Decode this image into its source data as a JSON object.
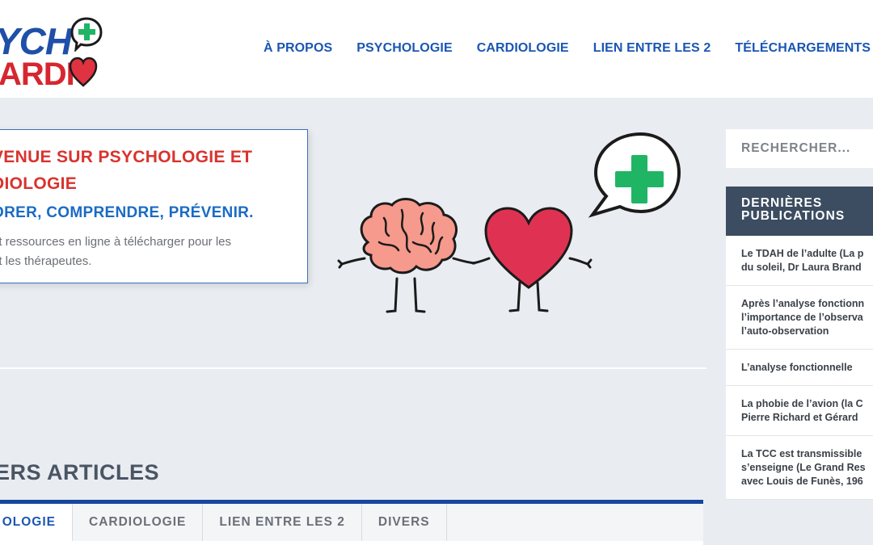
{
  "logo": {
    "top_text": "YCH",
    "bottom_text": "ARDI"
  },
  "nav": {
    "items": [
      "À PROPOS",
      "PSYCHOLOGIE",
      "CARDIOLOGIE",
      "LIEN ENTRE LES 2",
      "TÉLÉCHARGEMENTS"
    ]
  },
  "hero": {
    "title_line1": "VENUE SUR PSYCHOLOGIE ET",
    "title_line2": "DIOLOGIE",
    "subtitle": "ORER, COMPRENDRE, PRÉVENIR.",
    "desc_line1": "et ressources en ligne à télécharger pour les",
    "desc_line2": "et les thérapeutes."
  },
  "articles": {
    "title": "IERS ARTICLES",
    "tabs": [
      "OLOGIE",
      "CARDIOLOGIE",
      "LIEN ENTRE LES 2",
      "DIVERS"
    ]
  },
  "sidebar": {
    "search_placeholder": "RECHERCHER...",
    "widget_title_line1": "DERNIÈRES",
    "widget_title_line2": "PUBLICATIONS",
    "posts": [
      {
        "l1": "Le TDAH de l’adulte (La p",
        "l2": "du soleil, Dr Laura Brand"
      },
      {
        "l1": "Après l’analyse fonctionn",
        "l2": "l’importance de l’observa",
        "l3": "l’auto-observation"
      },
      {
        "l1": "L’analyse fonctionnelle"
      },
      {
        "l1": "La phobie de l’avion (la C",
        "l2": "Pierre Richard et Gérard"
      },
      {
        "l1": "La TCC est transmissible",
        "l2": "s’enseigne (Le Grand Res",
        "l3": "avec Louis de Funès, 196"
      }
    ]
  },
  "colors": {
    "nav": "#1a56b3",
    "hero_title": "#d9332e",
    "hero_sub": "#1a6bc4",
    "widget_head": "#3c4c61",
    "tab_bar": "#1547a0",
    "background": "#e9ecf1"
  }
}
